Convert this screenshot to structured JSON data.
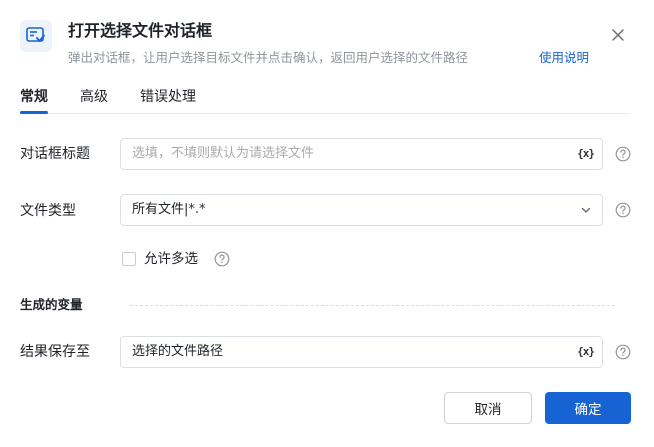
{
  "dialog": {
    "title": "打开选择文件对话框",
    "subtitle": "弹出对话框，让用户选择目标文件并点击确认，返回用户选择的文件路径",
    "help_link": "使用说明"
  },
  "tabs": [
    {
      "label": "常规",
      "active": true
    },
    {
      "label": "高级",
      "active": false
    },
    {
      "label": "错误处理",
      "active": false
    }
  ],
  "form": {
    "dialog_title": {
      "label": "对话框标题",
      "placeholder": "选填，不填则默认为请选择文件",
      "var_button": "{x}"
    },
    "file_type": {
      "label": "文件类型",
      "value": "所有文件|*.*"
    },
    "multi_select": {
      "label": "允许多选",
      "checked": false
    },
    "generated_vars_section": "生成的变量",
    "result_save": {
      "label": "结果保存至",
      "value": "选择的文件路径",
      "var_button": "{x}"
    }
  },
  "buttons": {
    "cancel": "取消",
    "ok": "确定"
  },
  "colors": {
    "accent": "#1664d4",
    "border": "#dcdfe5",
    "muted_text": "#8f959e"
  },
  "icons": {
    "header": "file-dialog-icon",
    "close": "close-icon",
    "help": "question-circle-icon",
    "dropdown": "chevron-down-icon"
  }
}
